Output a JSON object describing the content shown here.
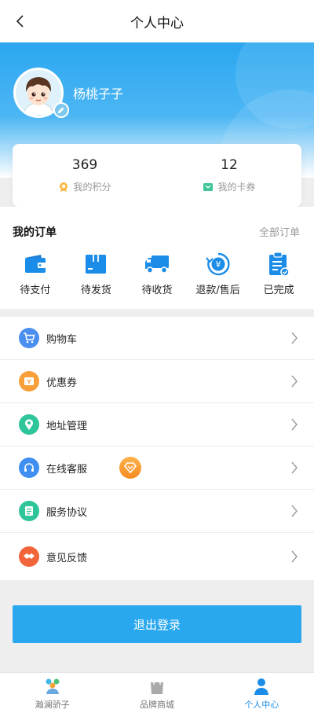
{
  "header": {
    "title": "个人中心"
  },
  "profile": {
    "username": "杨桃子子"
  },
  "stats": {
    "points": {
      "value": "369",
      "label": "我的积分"
    },
    "coupons": {
      "value": "12",
      "label": "我的卡券"
    }
  },
  "orders": {
    "title": "我的订单",
    "all_link": "全部订单",
    "items": [
      {
        "label": "待支付",
        "icon": "wallet-icon"
      },
      {
        "label": "待发货",
        "icon": "box-icon"
      },
      {
        "label": "待收货",
        "icon": "truck-icon"
      },
      {
        "label": "退款/售后",
        "icon": "refund-icon"
      },
      {
        "label": "已完成",
        "icon": "clipboard-check-icon"
      }
    ]
  },
  "menu": {
    "items": [
      {
        "label": "购物车",
        "icon": "cart-icon",
        "color": "#4a8ff0"
      },
      {
        "label": "优惠券",
        "icon": "coupon-icon",
        "color": "#f7a03a"
      },
      {
        "label": "地址管理",
        "icon": "location-pin-icon",
        "color": "#2fc59a"
      },
      {
        "label": "在线客服",
        "icon": "headset-icon",
        "color": "#3f8ff2"
      },
      {
        "label": "服务协议",
        "icon": "document-icon",
        "color": "#2fc59a"
      },
      {
        "label": "意见反馈",
        "icon": "handshake-icon",
        "color": "#f2653a"
      }
    ]
  },
  "logout": {
    "label": "退出登录"
  },
  "tabbar": {
    "items": [
      {
        "label": "瀚澜骄子",
        "icon": "group-icon",
        "active": false
      },
      {
        "label": "品牌商城",
        "icon": "shopping-bag-icon",
        "active": false
      },
      {
        "label": "个人中心",
        "icon": "person-icon",
        "active": true
      }
    ]
  },
  "colors": {
    "accent": "#29a8ef",
    "active_tab": "#1b8de8"
  }
}
